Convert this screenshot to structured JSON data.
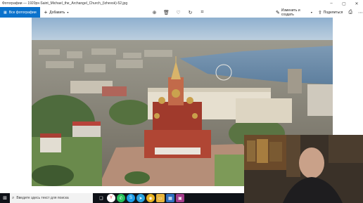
{
  "window": {
    "title": "Фотографии — 1920px-Saint_Michael_the_Archangel_Church_(Izhevsk)-52.jpg",
    "controls": [
      "–",
      "▢",
      "✕"
    ]
  },
  "toolbar": {
    "all_photos": "Все фотографии",
    "add": "Добавить",
    "edit_create": "Изменить и создать",
    "share": "Поделиться"
  },
  "taskbar": {
    "search_placeholder": "Введите здесь текст для поиска"
  },
  "colors": {
    "accent": "#0a72cc",
    "taskbar": "#0f1218"
  }
}
